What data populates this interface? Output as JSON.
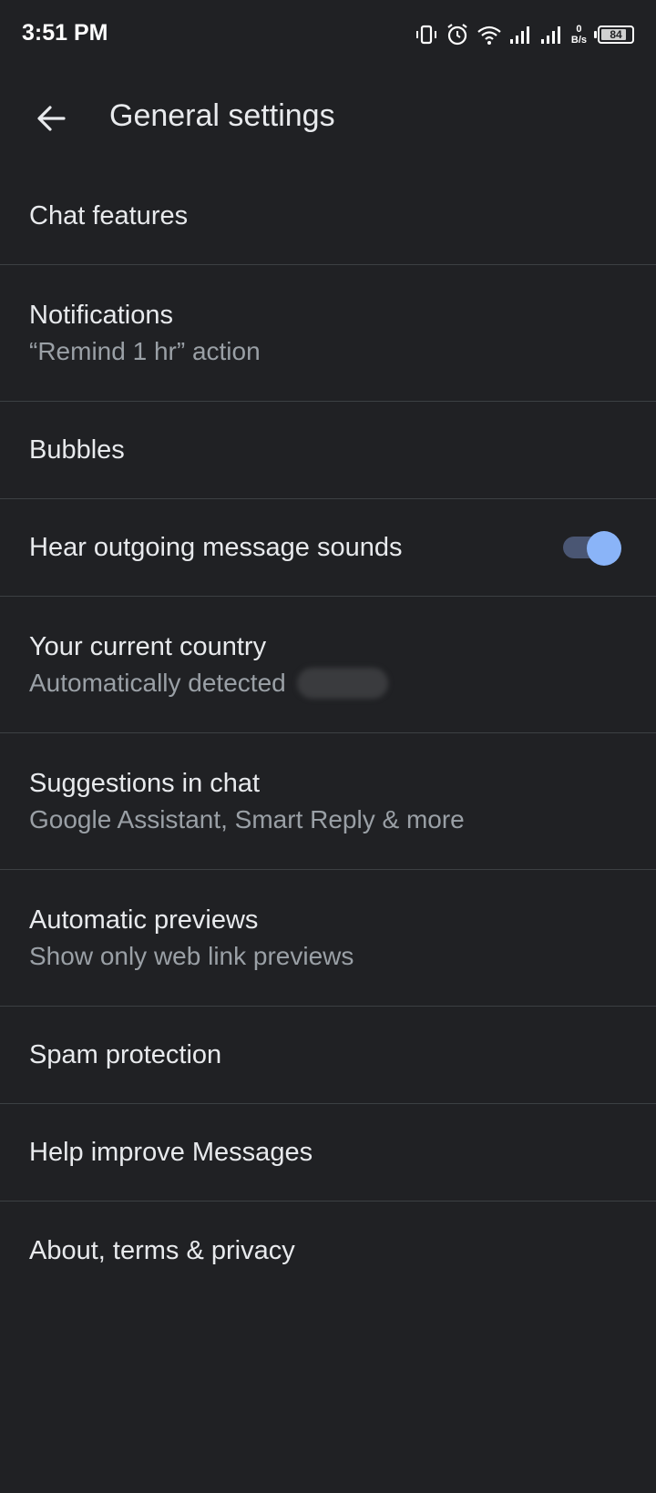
{
  "status_bar": {
    "time": "3:51 PM",
    "net_speed_value": "0",
    "net_speed_unit": "B/s",
    "battery_percent": "84",
    "battery_level": 0.84,
    "icons": [
      "vibrate-icon",
      "alarm-icon",
      "wifi-icon",
      "signal-icon",
      "signal-icon"
    ]
  },
  "header": {
    "title": "General settings",
    "back_icon": "arrow-back-icon"
  },
  "settings": {
    "chat_features": {
      "title": "Chat features"
    },
    "notifications": {
      "title": "Notifications",
      "subtitle": "“Remind 1 hr” action"
    },
    "bubbles": {
      "title": "Bubbles"
    },
    "outgoing_sounds": {
      "title": "Hear outgoing message sounds",
      "toggle_on": true
    },
    "current_country": {
      "title": "Your current country",
      "subtitle": "Automatically detected"
    },
    "suggestions": {
      "title": "Suggestions in chat",
      "subtitle": "Google Assistant, Smart Reply & more"
    },
    "automatic_previews": {
      "title": "Automatic previews",
      "subtitle": "Show only web link previews"
    },
    "spam_protection": {
      "title": "Spam protection"
    },
    "help_improve": {
      "title": "Help improve Messages"
    },
    "about": {
      "title": "About, terms & privacy"
    }
  },
  "colors": {
    "background": "#202124",
    "text_primary": "#e8eaed",
    "text_secondary": "#9aa0a6",
    "divider": "#3c4043",
    "toggle_thumb": "#8ab4f8",
    "toggle_track": "#4a5673"
  }
}
